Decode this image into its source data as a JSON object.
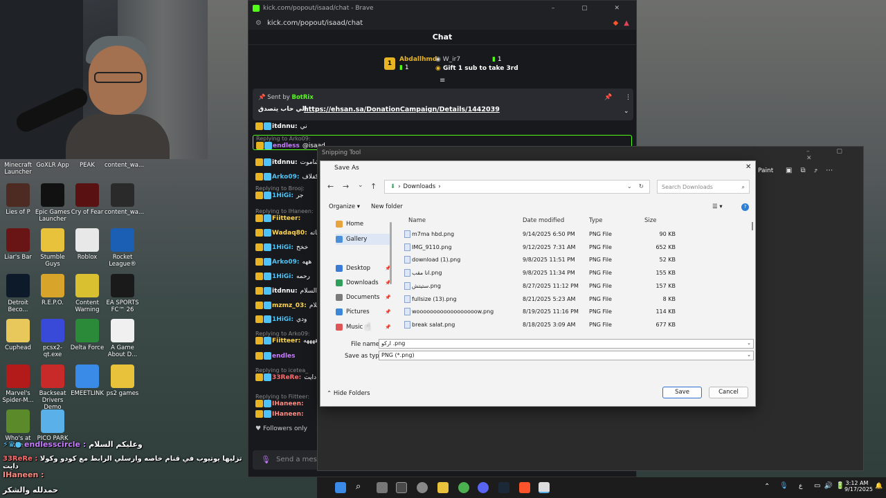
{
  "browser": {
    "tab_title": "kick.com/popout/isaad/chat - Brave",
    "url": "kick.com/popout/isaad/chat",
    "chat_header": "Chat",
    "leaderboard": {
      "first_name": "Abdallhmd",
      "first_count": "1",
      "second_name": "W_ir7",
      "second_count": "1",
      "gift_prompt": "Gift 1 sub to take 3rd"
    },
    "pinned": {
      "sent_by_label": "Sent by",
      "sender": "BotRix",
      "message": "الي حاب يتصدق",
      "link": "https://ehsan.sa/DonationCampaign/Details/1442039"
    },
    "chat_lines": [
      {
        "user": "itdnnu:",
        "text": "ني",
        "color": "#ffffff"
      },
      {
        "reply": "Replying to Arko09:",
        "user": "endless",
        "text": "@isaad",
        "color": "#c77dff"
      },
      {
        "user": "itdnnu:",
        "text": "هههههه شاموت",
        "color": "#ffffff"
      },
      {
        "user": "Arko09:",
        "text": "كفلاف",
        "color": "#4fc3f7"
      },
      {
        "reply": "Replying to Brooj:",
        "user": "1HiGi:",
        "text": "جر",
        "color": "#4fc3f7"
      },
      {
        "reply": "Replying to IHaneen:",
        "user": "Fiitteer:",
        "text": "",
        "color": "#ffd54f"
      },
      {
        "user": "Wadaq80:",
        "text": "ما شاء الله وبركاته",
        "color": "#ffd54f"
      },
      {
        "user": "1HiGi:",
        "text": "خخخ",
        "color": "#4fc3f7"
      },
      {
        "user": "Arko09:",
        "text": "ههه",
        "color": "#4fc3f7"
      },
      {
        "user": "1HiGi:",
        "text": "رحمه",
        "color": "#4fc3f7"
      },
      {
        "user": "itdnnu:",
        "text": "وعليكم السلام",
        "color": "#ffffff"
      },
      {
        "user": "mzmz_03:",
        "text": "كم السلام",
        "color": "#ffd54f"
      },
      {
        "user": "1HiGi:",
        "text": "ودي",
        "color": "#4fc3f7"
      },
      {
        "reply": "Replying to Arko09:",
        "user": "Fiitteer:",
        "text": "ههههه",
        "color": "#ffd54f"
      },
      {
        "user": "endles",
        "text": "",
        "color": "#c77dff"
      },
      {
        "reply": "Replying to icetea_",
        "user": "33ReRe:",
        "text": "كودو وكولا دايت",
        "color": "#ff6b6b"
      },
      {
        "reply": "Replying to Fiitteer:",
        "user": "IHaneen:",
        "text": "",
        "color": "#ff8a80"
      },
      {
        "user": "IHaneen:",
        "text": "",
        "color": "#ff8a80"
      }
    ],
    "followers_only": "Followers only",
    "send_placeholder": "Send a message"
  },
  "snipping_tool": {
    "title": "Snipping Tool",
    "paint_label": "Paint"
  },
  "dialog": {
    "title": "Save As",
    "breadcrumb": "Downloads",
    "search_placeholder": "Search Downloads",
    "organize": "Organize",
    "new_folder": "New folder",
    "nav_items": [
      {
        "label": "Home",
        "icon": "home-icon",
        "color": "#e8a33d",
        "pinned": false
      },
      {
        "label": "Gallery",
        "icon": "gallery-icon",
        "color": "#4a8fd8",
        "pinned": false
      },
      {
        "label": "Desktop",
        "icon": "desktop-icon",
        "color": "#3a7bd5",
        "pinned": true
      },
      {
        "label": "Downloads",
        "icon": "download-icon",
        "color": "#2e9e5b",
        "pinned": true
      },
      {
        "label": "Documents",
        "icon": "document-icon",
        "color": "#7a7a7a",
        "pinned": true
      },
      {
        "label": "Pictures",
        "icon": "pictures-icon",
        "color": "#3d88d6",
        "pinned": true
      },
      {
        "label": "Music",
        "icon": "music-icon",
        "color": "#e05555",
        "pinned": true
      }
    ],
    "columns": {
      "name": "Name",
      "date": "Date modified",
      "type": "Type",
      "size": "Size"
    },
    "files": [
      {
        "name": "m7ma hbd.png",
        "date": "9/14/2025 6:50 PM",
        "type": "PNG File",
        "size": "90 KB"
      },
      {
        "name": "IMG_9110.png",
        "date": "9/12/2025 7:31 AM",
        "type": "PNG File",
        "size": "652 KB"
      },
      {
        "name": "download (1).png",
        "date": "9/8/2025 11:51 PM",
        "type": "PNG File",
        "size": "52 KB"
      },
      {
        "name": "انا مقب.png",
        "date": "9/8/2025 11:34 PM",
        "type": "PNG File",
        "size": "155 KB"
      },
      {
        "name": "ستيتش.png",
        "date": "8/27/2025 11:12 PM",
        "type": "PNG File",
        "size": "157 KB"
      },
      {
        "name": "fullsize (13).png",
        "date": "8/21/2025 5:23 AM",
        "type": "PNG File",
        "size": "8 KB"
      },
      {
        "name": "woooooooooooooooooow.png",
        "date": "8/19/2025 11:16 PM",
        "type": "PNG File",
        "size": "114 KB"
      },
      {
        "name": "break salat.png",
        "date": "8/18/2025 3:09 AM",
        "type": "PNG File",
        "size": "677 KB"
      }
    ],
    "file_name_label": "File name:",
    "file_name_value": "اركو .png",
    "save_type_label": "Save as type:",
    "save_type_value": "PNG (*.png)",
    "hide_folders": "Hide Folders",
    "save": "Save",
    "cancel": "Cancel"
  },
  "desktop_icons": [
    {
      "label": "Minecraft Launcher",
      "color": "#5a8f3a"
    },
    {
      "label": "GoXLR App",
      "color": "#222"
    },
    {
      "label": "PEAK",
      "color": "#d97d2b"
    },
    {
      "label": "content_wa...",
      "color": "#333"
    },
    {
      "label": "Lies of P",
      "color": "#4d2a22"
    },
    {
      "label": "Epic Games Launcher",
      "color": "#111"
    },
    {
      "label": "Cry of Fear",
      "color": "#5a1111"
    },
    {
      "label": "content_wa...",
      "color": "#2a2a2a"
    },
    {
      "label": "Liar's Bar",
      "color": "#6a1515"
    },
    {
      "label": "Stumble Guys",
      "color": "#e8c23a"
    },
    {
      "label": "Roblox",
      "color": "#e8e8e8"
    },
    {
      "label": "Rocket League®",
      "color": "#1a5fb4"
    },
    {
      "label": "Detroit Beco...",
      "color": "#0d1a2a"
    },
    {
      "label": "R.E.P.O.",
      "color": "#d8a52a"
    },
    {
      "label": "Content Warning",
      "color": "#d8c030"
    },
    {
      "label": "EA SPORTS FC™ 26",
      "color": "#1a1a1a"
    },
    {
      "label": "Cuphead",
      "color": "#e8c85a"
    },
    {
      "label": "pcsx2-qt.exe",
      "color": "#3a4ad8"
    },
    {
      "label": "Delta Force",
      "color": "#2a8a3a"
    },
    {
      "label": "A Game About D...",
      "color": "#f0f0f0"
    },
    {
      "label": "Marvel's Spider-M...",
      "color": "#b31a1a"
    },
    {
      "label": "Backseat Drivers Demo",
      "color": "#c82a2a"
    },
    {
      "label": "EMEETLINK",
      "color": "#3a8ae8"
    },
    {
      "label": "ps2 games",
      "color": "#e8c23a"
    },
    {
      "label": "Who's at the",
      "color": "#5a8a2a"
    },
    {
      "label": "PICO PARK",
      "color": "#5ab0e8"
    }
  ],
  "overlay_chat": [
    {
      "user": "endlesscircle :",
      "text": "وعليكم السلام"
    },
    {
      "user": "33ReRe :",
      "text": "تزليها يوتيوب في قنام خاصه وارسلي الرابط مع كودو وكولا دايت"
    },
    {
      "user": "IHaneen :",
      "text": "حمدلله والشكر"
    }
  ],
  "taskbar": {
    "time": "3:12 AM",
    "date": "9/17/2025",
    "lang": "ع"
  }
}
